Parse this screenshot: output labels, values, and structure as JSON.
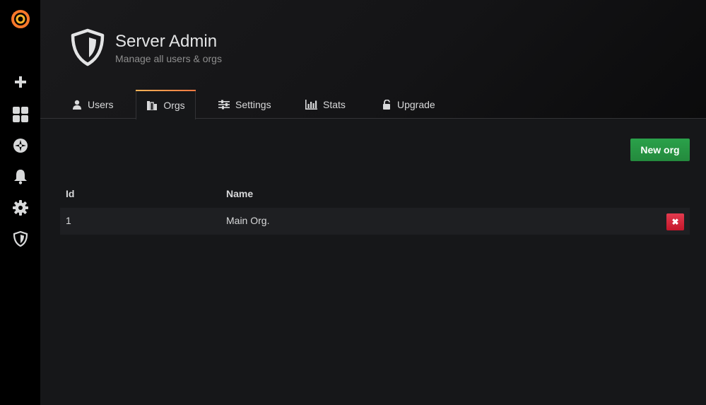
{
  "sidebar": {
    "items": [
      {
        "icon": "grafana-logo-icon"
      },
      {
        "icon": "plus-icon"
      },
      {
        "icon": "dashboards-grid-icon"
      },
      {
        "icon": "compass-explore-icon"
      },
      {
        "icon": "bell-alerting-icon"
      },
      {
        "icon": "gear-configuration-icon"
      },
      {
        "icon": "shield-server-admin-icon"
      }
    ]
  },
  "header": {
    "icon": "shield-icon",
    "title": "Server Admin",
    "subtitle": "Manage all users & orgs"
  },
  "tabs": [
    {
      "label": "Users",
      "icon": "user-icon",
      "active": false
    },
    {
      "label": "Orgs",
      "icon": "building-icon",
      "active": true
    },
    {
      "label": "Settings",
      "icon": "sliders-icon",
      "active": false
    },
    {
      "label": "Stats",
      "icon": "bar-chart-icon",
      "active": false
    },
    {
      "label": "Upgrade",
      "icon": "unlock-icon",
      "active": false
    }
  ],
  "actions": {
    "new_org_label": "New org"
  },
  "table": {
    "columns": [
      "Id",
      "Name"
    ],
    "rows": [
      {
        "id": "1",
        "name": "Main Org."
      }
    ],
    "delete_icon": "✖"
  },
  "colors": {
    "accent_gradient_start": "#ffb357",
    "accent_gradient_end": "#ff7941",
    "primary_green": "#299c46",
    "danger_red": "#e02f44"
  }
}
